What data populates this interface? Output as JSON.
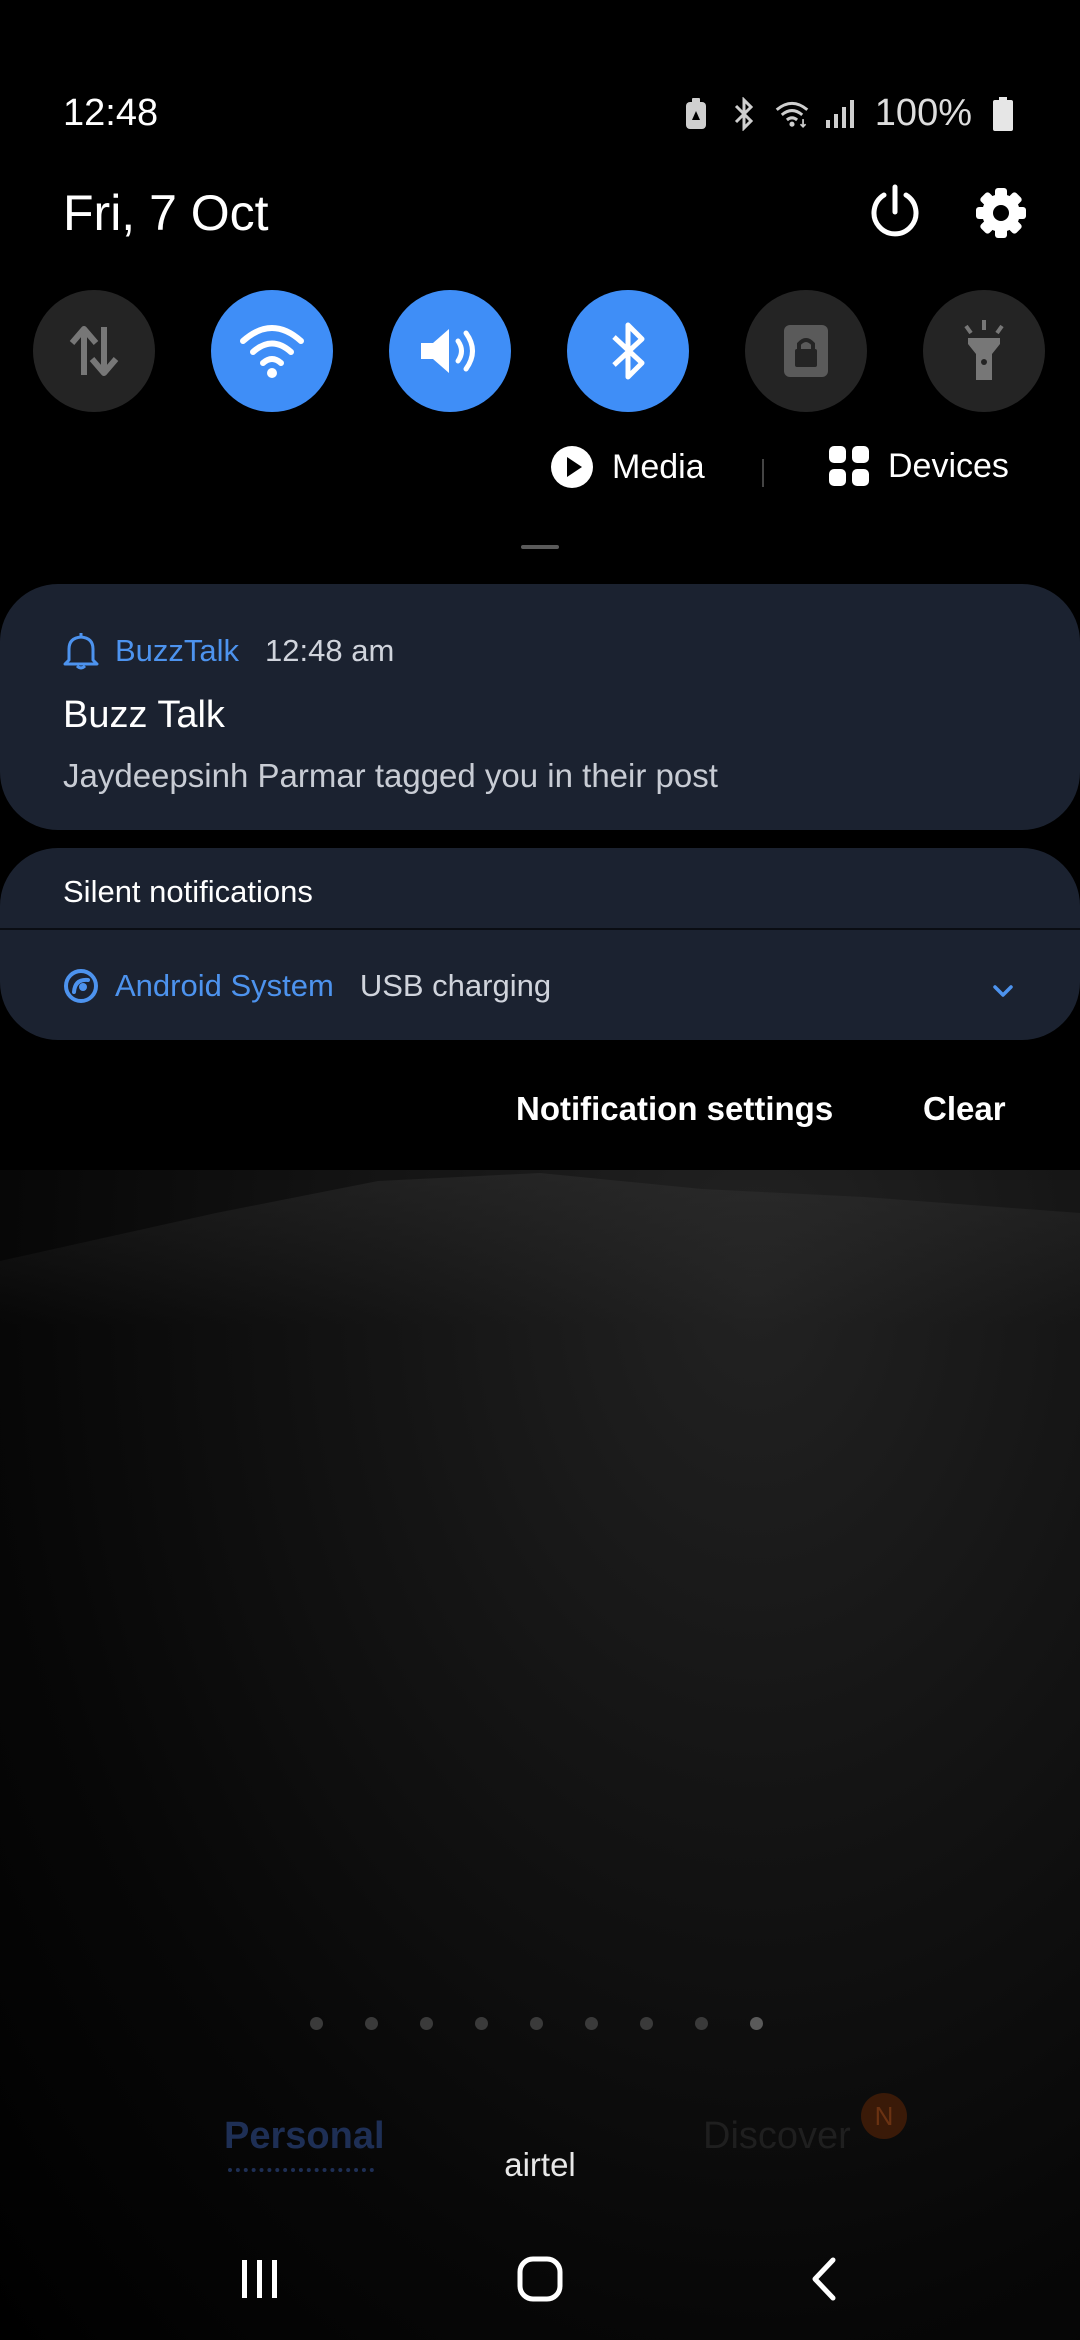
{
  "status_bar": {
    "time": "12:48",
    "battery_percent": "100%",
    "icons": [
      "battery-saver-icon",
      "bluetooth-icon",
      "wifi-icon",
      "signal-icon",
      "battery-icon"
    ]
  },
  "header": {
    "date": "Fri, 7 Oct",
    "icons": [
      "power-icon",
      "settings-gear-icon"
    ]
  },
  "quick_toggles": [
    {
      "name": "mobile-data",
      "icon": "data-arrows-icon",
      "state": "off"
    },
    {
      "name": "wifi",
      "icon": "wifi-icon",
      "state": "on"
    },
    {
      "name": "sound",
      "icon": "speaker-icon",
      "state": "on"
    },
    {
      "name": "bluetooth",
      "icon": "bluetooth-icon",
      "state": "on"
    },
    {
      "name": "screen-lock",
      "icon": "lock-icon",
      "state": "off"
    },
    {
      "name": "flashlight",
      "icon": "flashlight-icon",
      "state": "off"
    }
  ],
  "media_row": {
    "media_label": "Media",
    "devices_label": "Devices"
  },
  "notification": {
    "app_name": "BuzzTalk",
    "time": "12:48 am",
    "title": "Buzz Talk",
    "body": "Jaydeepsinh Parmar tagged you in their post"
  },
  "silent": {
    "header": "Silent notifications",
    "app_name": "Android System",
    "text": "USB charging"
  },
  "actions": {
    "notification_settings": "Notification settings",
    "clear": "Clear"
  },
  "home": {
    "page_count": 9,
    "active_page": 9,
    "tab_personal": "Personal",
    "tab_discover": "Discover",
    "discover_badge": "N",
    "carrier": "airtel"
  },
  "colors": {
    "accent": "#3f8ef7",
    "card": "#1b2230",
    "toggle_off": "#242424"
  }
}
